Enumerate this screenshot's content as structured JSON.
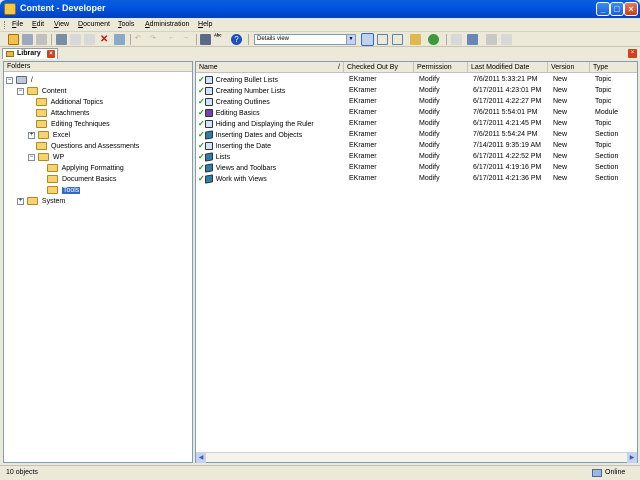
{
  "window": {
    "title": "Content - Developer"
  },
  "menu": [
    "File",
    "Edit",
    "View",
    "Document",
    "Tools",
    "Administration",
    "Help"
  ],
  "toolbar": {
    "view_value": "Details view"
  },
  "tab": {
    "label": "Library"
  },
  "folders": {
    "header": "Folders",
    "root": "/",
    "content": "Content",
    "children": [
      "Additional Topics",
      "Attachments",
      "Editing Techniques",
      "Excel",
      "Questions and Assessments",
      "WP"
    ],
    "wp_children": [
      "Applying Formatting",
      "Document Basics",
      "Tools"
    ],
    "system": "System"
  },
  "list": {
    "columns": [
      "Name",
      "Checked Out By",
      "Permission",
      "Last Modified Date",
      "Version",
      "Type"
    ],
    "sort_indicator": "/",
    "rows": [
      {
        "name": "Creating Bullet Lists",
        "by": "EKramer",
        "perm": "Modify",
        "date": "7/6/2011 5:33:21 PM",
        "ver": "New",
        "type": "Topic",
        "icon": "topic"
      },
      {
        "name": "Creating Number Lists",
        "by": "EKramer",
        "perm": "Modify",
        "date": "6/17/2011 4:23:01 PM",
        "ver": "New",
        "type": "Topic",
        "icon": "topic"
      },
      {
        "name": "Creating Outlines",
        "by": "EKramer",
        "perm": "Modify",
        "date": "6/17/2011 4:22:27 PM",
        "ver": "New",
        "type": "Topic",
        "icon": "topic"
      },
      {
        "name": "Editing Basics",
        "by": "EKramer",
        "perm": "Modify",
        "date": "7/6/2011 5:54:01 PM",
        "ver": "New",
        "type": "Module",
        "icon": "module"
      },
      {
        "name": "Hiding and Displaying the Ruler",
        "by": "EKramer",
        "perm": "Modify",
        "date": "6/17/2011 4:21:45 PM",
        "ver": "New",
        "type": "Topic",
        "icon": "topic"
      },
      {
        "name": "Inserting Dates and Objects",
        "by": "EKramer",
        "perm": "Modify",
        "date": "7/6/2011 5:54:24 PM",
        "ver": "New",
        "type": "Section",
        "icon": "section"
      },
      {
        "name": "Inserting the Date",
        "by": "EKramer",
        "perm": "Modify",
        "date": "7/14/2011 9:35:19 AM",
        "ver": "New",
        "type": "Topic",
        "icon": "topic"
      },
      {
        "name": "Lists",
        "by": "EKramer",
        "perm": "Modify",
        "date": "6/17/2011 4:22:52 PM",
        "ver": "New",
        "type": "Section",
        "icon": "section"
      },
      {
        "name": "Views and Toolbars",
        "by": "EKramer",
        "perm": "Modify",
        "date": "6/17/2011 4:19:16 PM",
        "ver": "New",
        "type": "Section",
        "icon": "section"
      },
      {
        "name": "Work with Views",
        "by": "EKramer",
        "perm": "Modify",
        "date": "6/17/2011 4:21:36 PM",
        "ver": "New",
        "type": "Section",
        "icon": "section"
      }
    ]
  },
  "status": {
    "count": "10 objects",
    "mode": "Online"
  }
}
